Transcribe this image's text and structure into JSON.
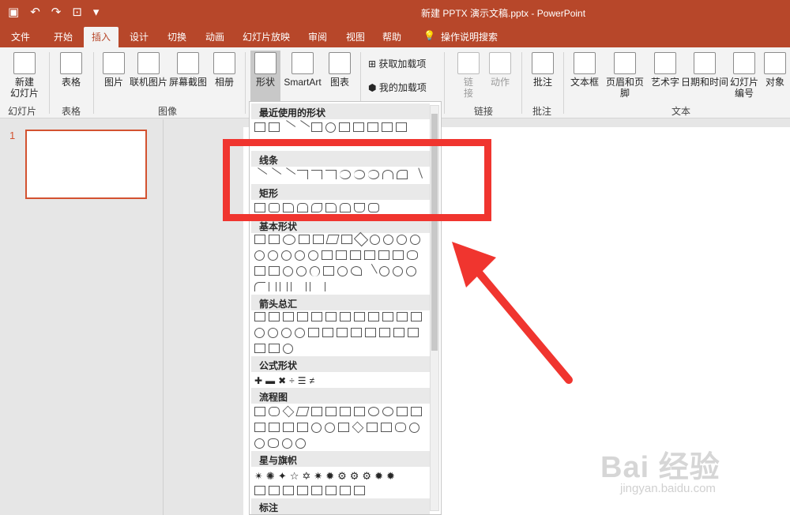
{
  "titlebar": {
    "title": "新建 PPTX 演示文稿.pptx  -  PowerPoint"
  },
  "tabs": [
    {
      "label": "文件"
    },
    {
      "label": "开始"
    },
    {
      "label": "插入"
    },
    {
      "label": "设计"
    },
    {
      "label": "切换"
    },
    {
      "label": "动画"
    },
    {
      "label": "幻灯片放映"
    },
    {
      "label": "审阅"
    },
    {
      "label": "视图"
    },
    {
      "label": "帮助"
    },
    {
      "label": "操作说明搜索"
    }
  ],
  "ribbon": {
    "new_slide": "新建\n幻灯片",
    "table": "表格",
    "picture": "图片",
    "online_picture": "联机图片",
    "screenshot": "屏幕截图",
    "album": "相册",
    "shapes": "形状",
    "smartart": "SmartArt",
    "chart": "图表",
    "get_addins": "获取加载项",
    "my_addins": "我的加载项",
    "link": "链\n接",
    "action": "动作",
    "comment": "批注",
    "textbox": "文本框",
    "header_footer": "页眉和页脚",
    "wordart": "艺术字",
    "datetime": "日期和时间",
    "slide_number": "幻灯片\n编号",
    "object": "对象",
    "groups": {
      "slides": "幻灯片",
      "tables": "表格",
      "images": "图像",
      "links": "链接",
      "comments": "批注",
      "text": "文本"
    }
  },
  "slides_pane": {
    "slide_number": "1"
  },
  "shapes_dropdown": {
    "sections": [
      {
        "title": "最近使用的形状"
      },
      {
        "title": "线条"
      },
      {
        "title": "矩形"
      },
      {
        "title": "基本形状"
      },
      {
        "title": "箭头总汇"
      },
      {
        "title": "公式形状"
      },
      {
        "title": "流程图"
      },
      {
        "title": "星与旗帜"
      },
      {
        "title": "标注"
      }
    ]
  },
  "watermark": {
    "brand": "Bai 经验",
    "url": "jingyan.baidu.com"
  },
  "colors": {
    "accent": "#b7472a",
    "highlight": "#f0352f"
  }
}
